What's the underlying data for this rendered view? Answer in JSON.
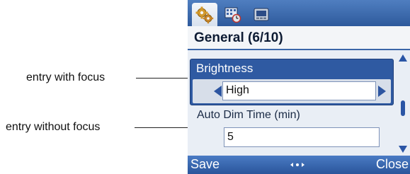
{
  "annotations": {
    "focus_label": "entry with focus",
    "nofocus_label": "entry without focus"
  },
  "tabs": [
    {
      "icon": "gears-icon",
      "active": true
    },
    {
      "icon": "display-settings-icon",
      "active": false
    },
    {
      "icon": "device-icon",
      "active": false
    }
  ],
  "header": {
    "title": "General (6/10)"
  },
  "entries": {
    "brightness": {
      "label": "Brightness",
      "value": "High"
    },
    "auto_dim": {
      "label": "Auto Dim Time (min)",
      "value": "5"
    }
  },
  "softkeys": {
    "left": "Save",
    "center_icon": "navigation-dots-icon",
    "right": "Close"
  },
  "colors": {
    "accent": "#2f5aa2",
    "bar": "#3a69b3",
    "background": "#e9eef5"
  }
}
